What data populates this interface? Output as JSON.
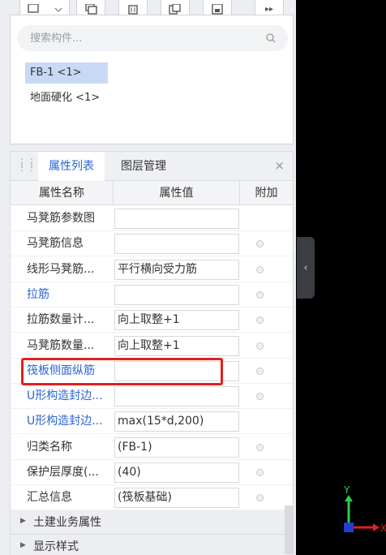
{
  "toolbar": {
    "more_label": "▸▸"
  },
  "component_list": {
    "search_placeholder": "搜索构件...",
    "items": [
      {
        "label": "FB-1 <1>",
        "selected": true
      },
      {
        "label": "地面硬化 <1>",
        "selected": false
      }
    ]
  },
  "tabs": {
    "properties": "属性列表",
    "layers": "图层管理",
    "close": "×"
  },
  "table": {
    "headers": {
      "name": "属性名称",
      "value": "属性值",
      "extra": "附加"
    },
    "rows": [
      {
        "name": "马凳筋参数图",
        "value": "",
        "blue": false,
        "dot": false
      },
      {
        "name": "马凳筋信息",
        "value": "",
        "blue": false,
        "dot": true
      },
      {
        "name": "线形马凳筋...",
        "value": "平行横向受力筋",
        "blue": false,
        "dot": true
      },
      {
        "name": "拉筋",
        "value": "",
        "blue": true,
        "dot": true
      },
      {
        "name": "拉筋数量计...",
        "value": "向上取整+1",
        "blue": false,
        "dot": true
      },
      {
        "name": "马凳筋数量...",
        "value": "向上取整+1",
        "blue": false,
        "dot": true
      },
      {
        "name": "筏板侧面纵筋",
        "value": "",
        "blue": true,
        "dot": true
      },
      {
        "name": "U形构造封边...",
        "value": "",
        "blue": true,
        "dot": true
      },
      {
        "name": "U形构造封边...",
        "value": "max(15*d,200)",
        "blue": true,
        "dot": false
      },
      {
        "name": "归类名称",
        "value": "(FB-1)",
        "blue": false,
        "dot": true
      },
      {
        "name": "保护层厚度(...",
        "value": "(40)",
        "blue": false,
        "dot": true
      },
      {
        "name": "汇总信息",
        "value": "(筏板基础)",
        "blue": false,
        "dot": true
      }
    ],
    "sections": [
      "土建业务属性",
      "显示样式"
    ]
  },
  "axis": {
    "y": "Y",
    "x": "X"
  },
  "colors": {
    "accent": "#2a64d6",
    "highlight": "#e02020",
    "selected_bg": "#c7d9f4"
  }
}
